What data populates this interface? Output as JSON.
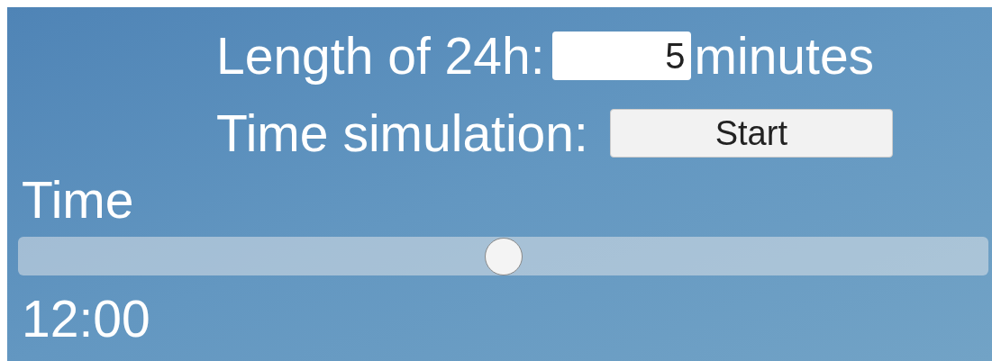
{
  "length_row": {
    "label": "Length of 24h:",
    "value": "5",
    "unit": "minutes"
  },
  "simulation_row": {
    "label": "Time simulation:",
    "button": "Start"
  },
  "time": {
    "label": "Time",
    "level": 0.5,
    "reading": "12:00"
  }
}
